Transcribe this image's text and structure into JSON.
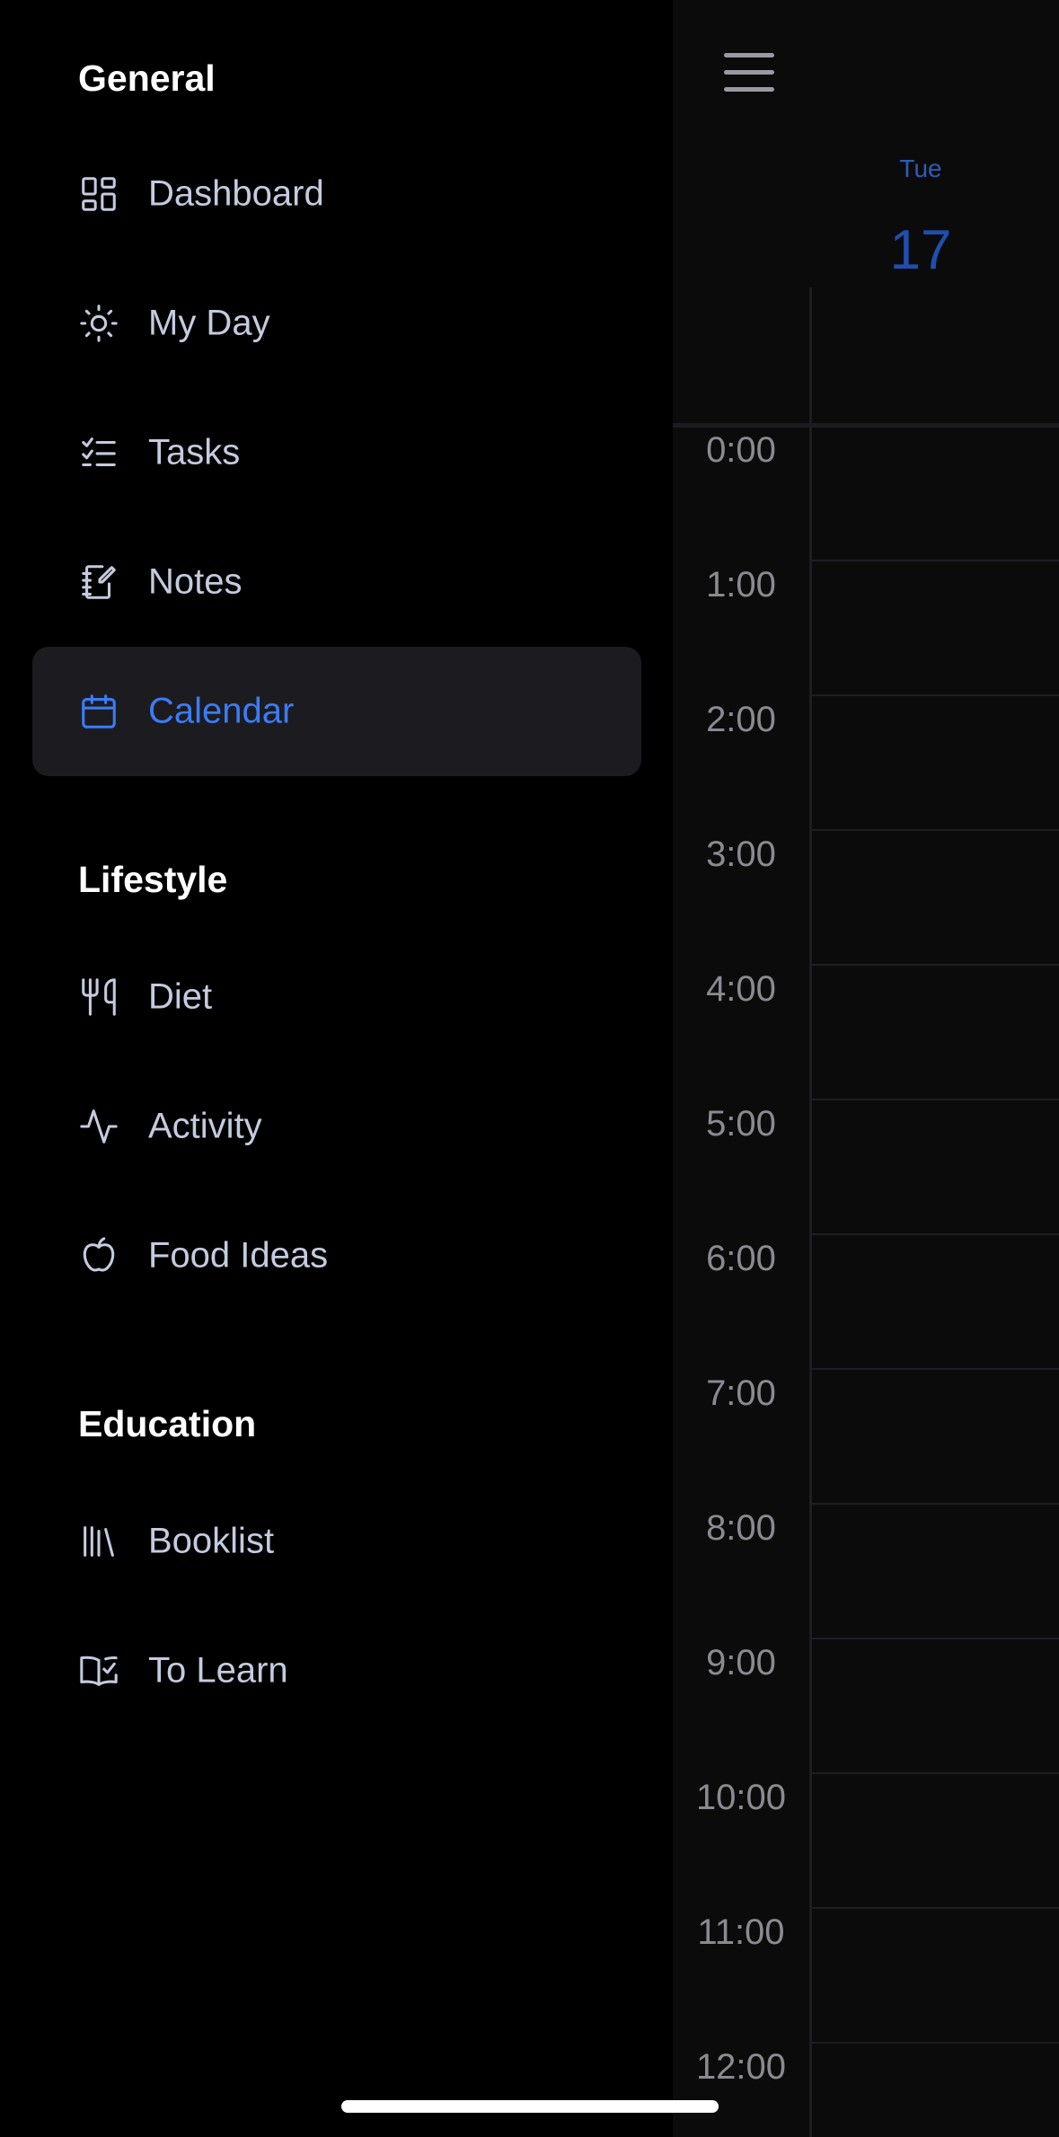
{
  "sidebar": {
    "sections": {
      "general": "General",
      "lifestyle": "Lifestyle",
      "education": "Education"
    },
    "items": {
      "dashboard": "Dashboard",
      "my_day": "My Day",
      "tasks": "Tasks",
      "notes": "Notes",
      "calendar": "Calendar",
      "diet": "Diet",
      "activity": "Activity",
      "food_ideas": "Food Ideas",
      "booklist": "Booklist",
      "to_learn": "To Learn"
    },
    "active_item": "Calendar"
  },
  "calendar": {
    "day_name": "Tue",
    "day_number": "17",
    "hours": [
      "0:00",
      "1:00",
      "2:00",
      "3:00",
      "4:00",
      "5:00",
      "6:00",
      "7:00",
      "8:00",
      "9:00",
      "10:00",
      "11:00",
      "12:00"
    ]
  },
  "colors": {
    "accent": "#3b7cf6",
    "background": "#000000",
    "text_primary": "#ffffff",
    "text_secondary": "#c3cbde",
    "active_bg": "#1c1c20"
  }
}
